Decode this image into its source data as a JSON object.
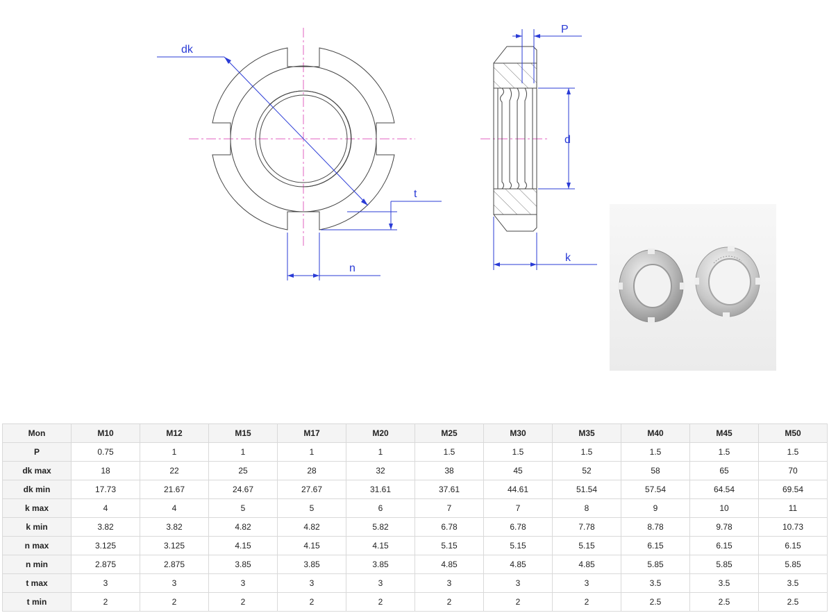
{
  "drawing": {
    "labels": {
      "dk": "dk",
      "t": "t",
      "n": "n",
      "P": "P",
      "d": "d",
      "k": "k"
    }
  },
  "photo": {
    "description_icon": "round-slotted-nut-photo"
  },
  "table": {
    "header": [
      "Mon",
      "M10",
      "M12",
      "M15",
      "M17",
      "M20",
      "M25",
      "M30",
      "M35",
      "M40",
      "M45",
      "M50"
    ],
    "rows": [
      {
        "name": "P",
        "values": [
          "0.75",
          "1",
          "1",
          "1",
          "1",
          "1.5",
          "1.5",
          "1.5",
          "1.5",
          "1.5",
          "1.5"
        ]
      },
      {
        "name": "dk max",
        "values": [
          "18",
          "22",
          "25",
          "28",
          "32",
          "38",
          "45",
          "52",
          "58",
          "65",
          "70"
        ]
      },
      {
        "name": "dk min",
        "values": [
          "17.73",
          "21.67",
          "24.67",
          "27.67",
          "31.61",
          "37.61",
          "44.61",
          "51.54",
          "57.54",
          "64.54",
          "69.54"
        ]
      },
      {
        "name": "k max",
        "values": [
          "4",
          "4",
          "5",
          "5",
          "6",
          "7",
          "7",
          "8",
          "9",
          "10",
          "11"
        ]
      },
      {
        "name": "k min",
        "values": [
          "3.82",
          "3.82",
          "4.82",
          "4.82",
          "5.82",
          "6.78",
          "6.78",
          "7.78",
          "8.78",
          "9.78",
          "10.73"
        ]
      },
      {
        "name": "n max",
        "values": [
          "3.125",
          "3.125",
          "4.15",
          "4.15",
          "4.15",
          "5.15",
          "5.15",
          "5.15",
          "6.15",
          "6.15",
          "6.15"
        ]
      },
      {
        "name": "n min",
        "values": [
          "2.875",
          "2.875",
          "3.85",
          "3.85",
          "3.85",
          "4.85",
          "4.85",
          "4.85",
          "5.85",
          "5.85",
          "5.85"
        ]
      },
      {
        "name": "t max",
        "values": [
          "3",
          "3",
          "3",
          "3",
          "3",
          "3",
          "3",
          "3",
          "3.5",
          "3.5",
          "3.5"
        ]
      },
      {
        "name": "t min",
        "values": [
          "2",
          "2",
          "2",
          "2",
          "2",
          "2",
          "2",
          "2",
          "2.5",
          "2.5",
          "2.5"
        ]
      }
    ]
  }
}
